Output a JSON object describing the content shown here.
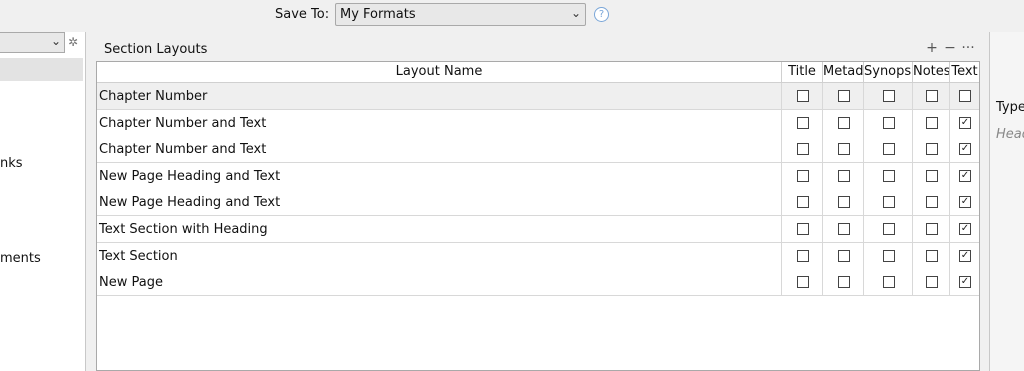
{
  "topbar": {
    "save_to_label": "Save To:",
    "save_to_value": "My Formats"
  },
  "left_panel": {
    "items": [
      "nks",
      "ments"
    ]
  },
  "right_panel": {
    "text1": "Type",
    "text2": "Head"
  },
  "section": {
    "title": "Section Layouts",
    "add": "+",
    "remove": "−",
    "more": "···"
  },
  "table": {
    "headers": [
      "Layout Name",
      "Title",
      "Metadata",
      "Synopsis",
      "Notes",
      "Text"
    ],
    "rows": [
      {
        "name": "Chapter Number",
        "title": false,
        "meta": false,
        "syn": false,
        "notes": false,
        "text": false
      },
      {
        "name": "Chapter Number and Text",
        "title": false,
        "meta": false,
        "syn": false,
        "notes": false,
        "text": true
      },
      {
        "name": "Chapter Number and Text",
        "title": false,
        "meta": false,
        "syn": false,
        "notes": false,
        "text": true
      },
      {
        "name": "New Page Heading and Text",
        "title": false,
        "meta": false,
        "syn": false,
        "notes": false,
        "text": true
      },
      {
        "name": "New Page Heading and Text",
        "title": false,
        "meta": false,
        "syn": false,
        "notes": false,
        "text": true
      },
      {
        "name": "Text Section with Heading",
        "title": false,
        "meta": false,
        "syn": false,
        "notes": false,
        "text": true
      },
      {
        "name": "Text Section",
        "title": false,
        "meta": false,
        "syn": false,
        "notes": false,
        "text": true
      },
      {
        "name": "New Page",
        "title": false,
        "meta": false,
        "syn": false,
        "notes": false,
        "text": true
      }
    ]
  }
}
